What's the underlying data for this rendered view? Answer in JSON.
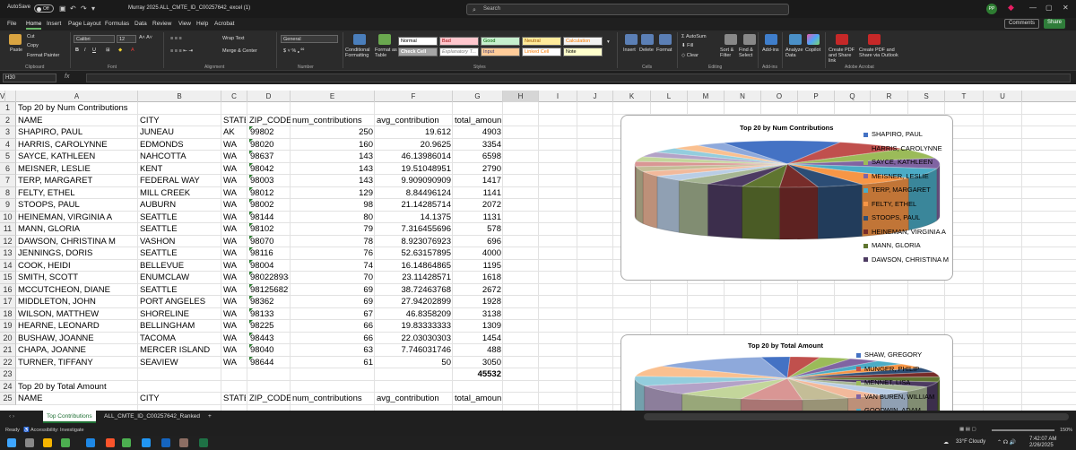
{
  "titlebar": {
    "autosave_label": "AutoSave",
    "autosave_state": "Off",
    "filename": "Murray 2025 ALL_CMTE_ID_C00257642_excel (1)",
    "search_placeholder": "Search",
    "user_initials": "PP"
  },
  "menu": {
    "items": [
      "File",
      "Home",
      "Insert",
      "Page Layout",
      "Formulas",
      "Data",
      "Review",
      "View",
      "Help",
      "Acrobat"
    ],
    "active": "Home",
    "comments_label": "Comments",
    "share_label": "Share"
  },
  "ribbon": {
    "paste": "Paste",
    "cut": "Cut",
    "copy": "Copy",
    "format_painter": "Format Painter",
    "clipboard": "Clipboard",
    "font_name": "Calibri",
    "font_size": "12",
    "font_group": "Font",
    "wrap_text": "Wrap Text",
    "merge_center": "Merge & Center",
    "alignment": "Alignment",
    "number_format": "General",
    "number_group": "Number",
    "conditional_formatting": "Conditional Formatting",
    "format_as_table": "Format as Table",
    "styles": [
      "Normal",
      "Bad",
      "Good",
      "Neutral",
      "Calculation",
      "Check Cell",
      "Explanatory T...",
      "Input",
      "Linked Cell",
      "Note"
    ],
    "styles_group": "Styles",
    "insert": "Insert",
    "delete": "Delete",
    "format": "Format",
    "cells_group": "Cells",
    "autosum": "AutoSum",
    "fill": "Fill",
    "clear": "Clear",
    "sort_filter": "Sort & Filter",
    "find_select": "Find & Select",
    "editing_group": "Editing",
    "addins": "Add-ins",
    "addins_group": "Add-ins",
    "analyze_data": "Analyze Data",
    "copilot": "Copilot",
    "create_pdf_share": "Create PDF and Share link",
    "create_pdf_outlook": "Create PDF and Share via Outlook",
    "adobe_group": "Adobe Acrobat"
  },
  "formula_bar": {
    "name_box": "H30",
    "fx": "fx",
    "value": ""
  },
  "sheet": {
    "columns": [
      "A",
      "B",
      "C",
      "D",
      "E",
      "F",
      "G",
      "H",
      "I",
      "J",
      "K",
      "L",
      "M",
      "N",
      "O",
      "P",
      "Q",
      "R",
      "S",
      "T",
      "U",
      "V"
    ],
    "selected_column": "H",
    "row_numbers": [
      "1",
      "2",
      "3",
      "4",
      "5",
      "6",
      "7",
      "8",
      "9",
      "10",
      "11",
      "12",
      "13",
      "14",
      "15",
      "16",
      "17",
      "18",
      "19",
      "20",
      "21",
      "22",
      "23",
      "24",
      "25"
    ],
    "title1": "Top 20 by Num Contributions",
    "headers": [
      "NAME",
      "CITY",
      "STATE",
      "ZIP_CODE",
      "num_contributions",
      "avg_contribution",
      "total_amount"
    ],
    "rows": [
      [
        "SHAPIRO, PAUL",
        "JUNEAU",
        "AK",
        "99802",
        "250",
        "19.612",
        "4903"
      ],
      [
        "HARRIS, CAROLYNNE",
        "EDMONDS",
        "WA",
        "98020",
        "160",
        "20.9625",
        "3354"
      ],
      [
        "SAYCE, KATHLEEN",
        "NAHCOTTA",
        "WA",
        "98637",
        "143",
        "46.13986014",
        "6598"
      ],
      [
        "MEISNER, LESLIE",
        "KENT",
        "WA",
        "98042",
        "143",
        "19.51048951",
        "2790"
      ],
      [
        "TERP, MARGARET",
        "FEDERAL WAY",
        "WA",
        "98003",
        "143",
        "9.909090909",
        "1417"
      ],
      [
        "FELTY, ETHEL",
        "MILL CREEK",
        "WA",
        "98012",
        "129",
        "8.84496124",
        "1141"
      ],
      [
        "STOOPS, PAUL",
        "AUBURN",
        "WA",
        "98002",
        "98",
        "21.14285714",
        "2072"
      ],
      [
        "HEINEMAN, VIRGINIA A",
        "SEATTLE",
        "WA",
        "98144",
        "80",
        "14.1375",
        "1131"
      ],
      [
        "MANN, GLORIA",
        "SEATTLE",
        "WA",
        "98102",
        "79",
        "7.316455696",
        "578"
      ],
      [
        "DAWSON, CHRISTINA M",
        "VASHON",
        "WA",
        "98070",
        "78",
        "8.923076923",
        "696"
      ],
      [
        "JENNINGS, DORIS",
        "SEATTLE",
        "WA",
        "98116",
        "76",
        "52.63157895",
        "4000"
      ],
      [
        "COOK, HEIDI",
        "BELLEVUE",
        "WA",
        "98004",
        "74",
        "16.14864865",
        "1195"
      ],
      [
        "SMITH, SCOTT",
        "ENUMCLAW",
        "WA",
        "980228938",
        "70",
        "23.11428571",
        "1618"
      ],
      [
        "MCCUTCHEON, DIANE",
        "SEATTLE",
        "WA",
        "981256827",
        "69",
        "38.72463768",
        "2672"
      ],
      [
        "MIDDLETON, JOHN",
        "PORT ANGELES",
        "WA",
        "98362",
        "69",
        "27.94202899",
        "1928"
      ],
      [
        "WILSON, MATTHEW",
        "SHORELINE",
        "WA",
        "98133",
        "67",
        "46.8358209",
        "3138"
      ],
      [
        "HEARNE, LEONARD",
        "BELLINGHAM",
        "WA",
        "98225",
        "66",
        "19.83333333",
        "1309"
      ],
      [
        "BUSHAW, JOANNE",
        "TACOMA",
        "WA",
        "98443",
        "66",
        "22.03030303",
        "1454"
      ],
      [
        "CHAPA, JOANNE",
        "MERCER ISLAND",
        "WA",
        "98040",
        "63",
        "7.746031746",
        "488"
      ],
      [
        "TURNER, TIFFANY",
        "SEAVIEW",
        "WA",
        "98644",
        "61",
        "50",
        "3050"
      ]
    ],
    "total": "45532",
    "title2": "Top 20 by Total Amount",
    "headers2": [
      "NAME",
      "CITY",
      "STATE",
      "ZIP_CODE",
      "num_contributions",
      "avg_contribution",
      "total_amount"
    ]
  },
  "chart_data": [
    {
      "type": "pie",
      "title": "Top 20 by Num Contributions",
      "legend_position": "right",
      "legend": [
        "SHAPIRO, PAUL",
        "HARRIS, CAROLYNNE",
        "SAYCE, KATHLEEN",
        "MEISNER, LESLIE",
        "TERP, MARGARET",
        "FELTY, ETHEL",
        "STOOPS, PAUL",
        "HEINEMAN, VIRGINIA A",
        "MANN, GLORIA",
        "DAWSON, CHRISTINA M"
      ],
      "colors": [
        "#4472c4",
        "#c0504d",
        "#9bbb59",
        "#8064a2",
        "#4bacc6",
        "#f79646",
        "#2c4d75",
        "#772c2a",
        "#5f7530",
        "#4d3b62",
        "#a5b592",
        "#b9cde5",
        "#f2b99b",
        "#c4bd97",
        "#d99694",
        "#c3d69b",
        "#b3a2c7",
        "#93cddd",
        "#fac090",
        "#8ea9db"
      ],
      "values": [
        250,
        160,
        143,
        143,
        143,
        129,
        98,
        80,
        79,
        78,
        76,
        74,
        70,
        69,
        69,
        67,
        66,
        66,
        63,
        61
      ]
    },
    {
      "type": "pie",
      "title": "Top 20 by Total Amount",
      "legend_position": "right",
      "legend": [
        "SHAW, GREGORY",
        "MUNGER, PHILIP",
        "MENNET, LISA",
        "VAN BUREN, WILLIAM",
        "GOODWIN, ADAM"
      ],
      "colors": [
        "#4472c4",
        "#c0504d",
        "#9bbb59",
        "#8064a2",
        "#4bacc6",
        "#f79646",
        "#2c4d75",
        "#772c2a",
        "#5f7530",
        "#4d3b62",
        "#a5b592",
        "#b9cde5",
        "#f2b99b",
        "#c4bd97",
        "#d99694",
        "#c3d69b",
        "#b3a2c7",
        "#93cddd",
        "#fac090",
        "#8ea9db"
      ]
    }
  ],
  "tabs": {
    "items": [
      "Top Contributions",
      "ALL_CMTE_ID_C00257642_Ranked"
    ],
    "active": "Top Contributions",
    "add": "+"
  },
  "status": {
    "ready": "Ready",
    "accessibility": "Accessibility: Investigate",
    "zoom": "150%"
  },
  "taskbar": {
    "weather": "33°F Cloudy",
    "time": "7:42:07 AM",
    "date": "2/26/2025"
  }
}
